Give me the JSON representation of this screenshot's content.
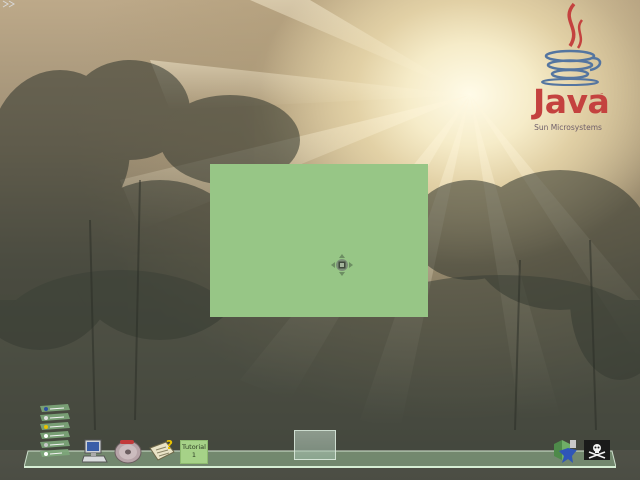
{
  "desktop": {
    "background": "sunrise-through-trees-wallpaper",
    "accent_colors": {
      "panel": "#97c686",
      "java_red": "#c4423f",
      "java_blue": "#5475a0"
    }
  },
  "logo": {
    "word": "Java",
    "trademark": "™",
    "subtitle": "Sun Microsystems"
  },
  "center_panel": {
    "icon": "move-cursor-icon"
  },
  "dock": {
    "items": [
      {
        "name": "launcher-stack",
        "icon": "app-list-icon"
      },
      {
        "name": "computer",
        "icon": "computer-icon"
      },
      {
        "name": "disc",
        "icon": "cd-disc-icon"
      },
      {
        "name": "help",
        "icon": "help-question-icon"
      },
      {
        "name": "tutorial",
        "label_line1": "Tutorial",
        "label_line2": "1"
      },
      {
        "name": "window-thumbnail",
        "icon": "window-thumbnail"
      },
      {
        "name": "shield",
        "icon": "shield-star-icon"
      },
      {
        "name": "pirate",
        "icon": "skull-crossbones-icon"
      }
    ]
  }
}
